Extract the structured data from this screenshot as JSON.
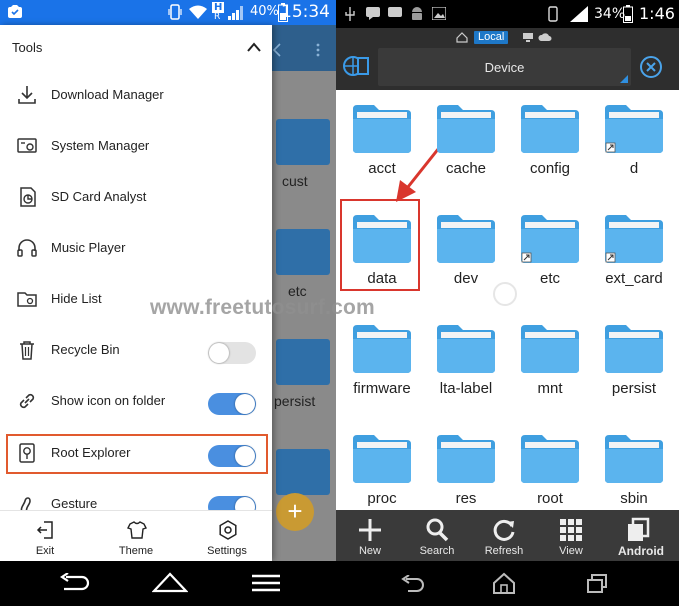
{
  "left": {
    "status_bar": {
      "battery": "40%",
      "time": "15:34",
      "network": "H",
      "signal_letter": "R"
    },
    "background_app": {
      "folder_labels": [
        "cust",
        "etc",
        "persist"
      ],
      "fab_symbol": "+"
    },
    "drawer": {
      "header": "Tools",
      "items": [
        {
          "label": "Download Manager",
          "icon": "download-icon"
        },
        {
          "label": "System Manager",
          "icon": "system-manager-icon"
        },
        {
          "label": "SD Card Analyst",
          "icon": "sd-card-analyst-icon"
        },
        {
          "label": "Music Player",
          "icon": "headphones-icon"
        },
        {
          "label": "Hide List",
          "icon": "hide-list-folder-icon"
        },
        {
          "label": "Recycle Bin",
          "icon": "trash-icon",
          "toggle": false
        },
        {
          "label": "Show icon on folder",
          "icon": "link-icon",
          "toggle": true
        },
        {
          "label": "Root Explorer",
          "icon": "root-explorer-icon",
          "toggle": true
        },
        {
          "label": "Gesture",
          "icon": "gesture-icon",
          "toggle": true
        }
      ],
      "bottom": [
        {
          "label": "Exit",
          "icon": "exit-icon"
        },
        {
          "label": "Theme",
          "icon": "theme-shirt-icon"
        },
        {
          "label": "Settings",
          "icon": "gear-icon"
        }
      ]
    }
  },
  "right": {
    "status_bar": {
      "battery": "34%",
      "time": "1:46"
    },
    "toolbar": {
      "location": "Local",
      "title": "Device"
    },
    "folders": [
      "acct",
      "cache",
      "config",
      "d",
      "data",
      "dev",
      "etc",
      "ext_card",
      "firmware",
      "lta-label",
      "mnt",
      "persist",
      "proc",
      "res",
      "root",
      "sbin"
    ],
    "bottom_bar": [
      {
        "label": "New",
        "icon": "plus-icon"
      },
      {
        "label": "Search",
        "icon": "search-icon"
      },
      {
        "label": "Refresh",
        "icon": "refresh-icon"
      },
      {
        "label": "View",
        "icon": "grid-view-icon"
      },
      {
        "label": "Android",
        "icon": "android-windows-icon"
      }
    ]
  },
  "watermark": "www.freetutosurf.com",
  "colors": {
    "left_status": "#1a73e8",
    "toggle_on": "#4a8fe0",
    "folder_blue": "#5bb4ee",
    "highlight_orange": "#e15a2e",
    "highlight_red": "#d9362d"
  }
}
